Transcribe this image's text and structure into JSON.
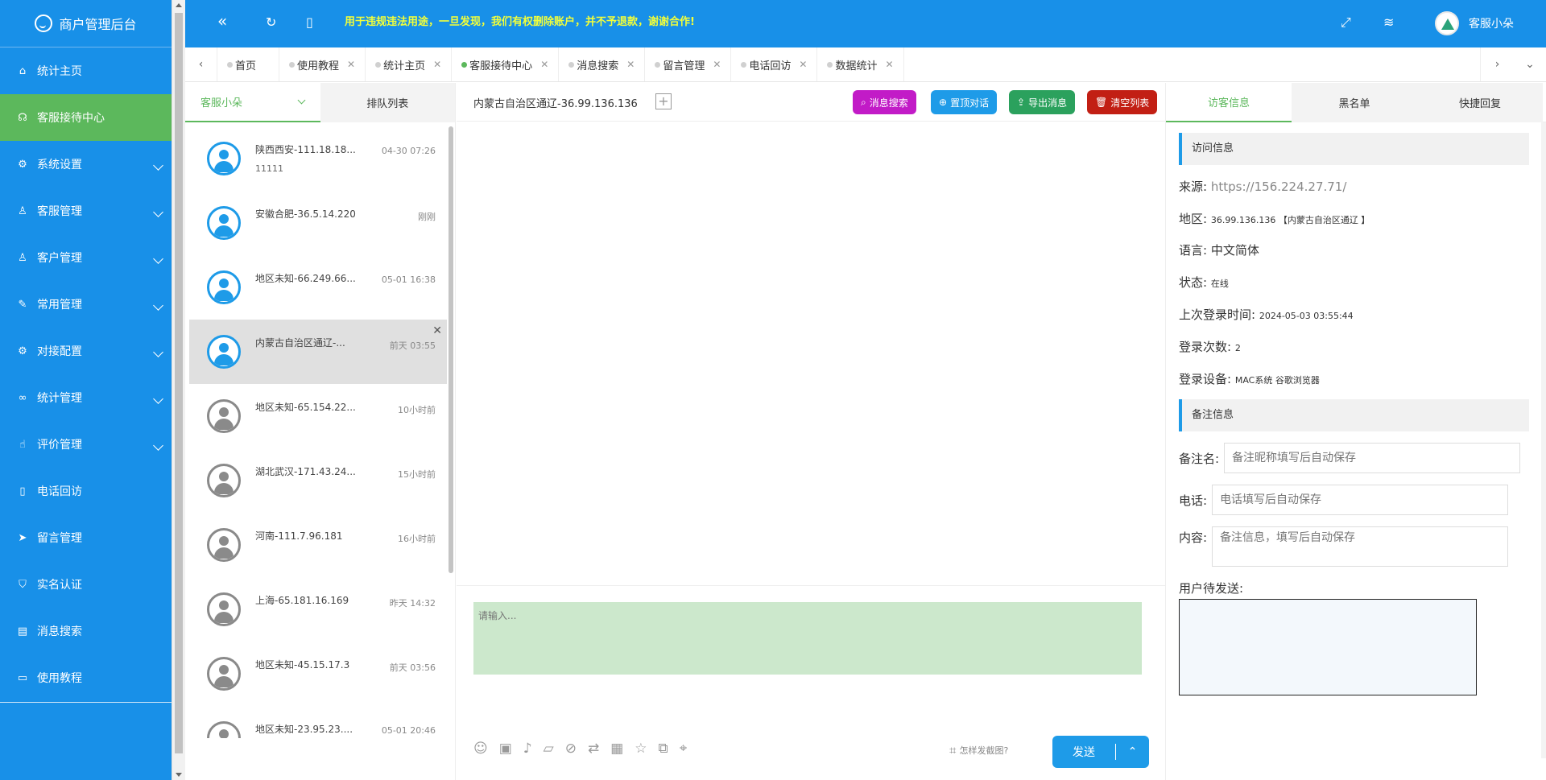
{
  "sidebar": {
    "brand": "商户管理后台",
    "items": [
      {
        "label": "统计主页",
        "icon": "home-icon",
        "glyph": "⌂",
        "has_children": false,
        "active": false
      },
      {
        "label": "客服接待中心",
        "icon": "headset-icon",
        "glyph": "☊",
        "has_children": false,
        "active": true
      },
      {
        "label": "系统设置",
        "icon": "gear-icon",
        "glyph": "⚙",
        "has_children": true,
        "active": false
      },
      {
        "label": "客服管理",
        "icon": "user-icon",
        "glyph": "♙",
        "has_children": true,
        "active": false
      },
      {
        "label": "客户管理",
        "icon": "users-icon",
        "glyph": "♙",
        "has_children": true,
        "active": false
      },
      {
        "label": "常用管理",
        "icon": "edit-icon",
        "glyph": "✎",
        "has_children": true,
        "active": false
      },
      {
        "label": "对接配置",
        "icon": "settings-icon",
        "glyph": "⚙",
        "has_children": true,
        "active": false
      },
      {
        "label": "统计管理",
        "icon": "link-icon",
        "glyph": "∞",
        "has_children": true,
        "active": false
      },
      {
        "label": "评价管理",
        "icon": "thumb-up-icon",
        "glyph": "☝",
        "has_children": true,
        "active": false
      },
      {
        "label": "电话回访",
        "icon": "phone-icon",
        "glyph": "▯",
        "has_children": false,
        "active": false
      },
      {
        "label": "留言管理",
        "icon": "send-icon",
        "glyph": "➤",
        "has_children": false,
        "active": false
      },
      {
        "label": "实名认证",
        "icon": "shield-check-icon",
        "glyph": "⛉",
        "has_children": false,
        "active": false
      },
      {
        "label": "消息搜索",
        "icon": "clipboard-icon",
        "glyph": "▤",
        "has_children": false,
        "active": false
      },
      {
        "label": "使用教程",
        "icon": "book-icon",
        "glyph": "▭",
        "has_children": false,
        "active": false
      }
    ]
  },
  "topbar": {
    "notice": "用于违规违法用途，一旦发现，我们有权删除账户，并不予退款，谢谢合作!",
    "username": "客服小朵",
    "notice_color": "#f2ff3a"
  },
  "tabs": [
    {
      "label": "首页",
      "closable": false,
      "active": false
    },
    {
      "label": "使用教程",
      "closable": true,
      "active": false
    },
    {
      "label": "统计主页",
      "closable": true,
      "active": false
    },
    {
      "label": "客服接待中心",
      "closable": true,
      "active": true
    },
    {
      "label": "消息搜索",
      "closable": true,
      "active": false
    },
    {
      "label": "留言管理",
      "closable": true,
      "active": false
    },
    {
      "label": "电话回访",
      "closable": true,
      "active": false
    },
    {
      "label": "数据统计",
      "closable": true,
      "active": false
    }
  ],
  "conversations": {
    "tab_agent": "客服小朵",
    "tab_queue": "排队列表",
    "items": [
      {
        "name": "陕西西安-111.18.18...",
        "sub": "11111",
        "time": "04-30 07:26",
        "online": true,
        "selected": false
      },
      {
        "name": "安徽合肥-36.5.14.220",
        "sub": "",
        "time": "刚刚",
        "online": true,
        "selected": false
      },
      {
        "name": "地区未知-66.249.66...",
        "sub": "",
        "time": "05-01 16:38",
        "online": true,
        "selected": false
      },
      {
        "name": "内蒙古自治区通辽-...",
        "sub": "",
        "time": "前天 03:55",
        "online": true,
        "selected": true
      },
      {
        "name": "地区未知-65.154.22...",
        "sub": "",
        "time": "10小时前",
        "online": false,
        "selected": false
      },
      {
        "name": "湖北武汉-171.43.24...",
        "sub": "",
        "time": "15小时前",
        "online": false,
        "selected": false
      },
      {
        "name": "河南-111.7.96.181",
        "sub": "",
        "time": "16小时前",
        "online": false,
        "selected": false
      },
      {
        "name": "上海-65.181.16.169",
        "sub": "",
        "time": "昨天 14:32",
        "online": false,
        "selected": false
      },
      {
        "name": "地区未知-45.15.17.3",
        "sub": "",
        "time": "前天 03:56",
        "online": false,
        "selected": false
      },
      {
        "name": "地区未知-23.95.23....",
        "sub": "",
        "time": "05-01 20:46",
        "online": false,
        "selected": false
      }
    ]
  },
  "chat": {
    "title": "内蒙古自治区通辽-36.99.136.136",
    "buttons": {
      "search": "消息搜索",
      "top": "置顶对话",
      "export": "导出消息",
      "clear": "清空列表"
    },
    "input_placeholder": "请输入...",
    "screenshot_hint": "怎样发截图?",
    "send_label": "发送"
  },
  "right_panel": {
    "tabs": [
      "访客信息",
      "黑名单",
      "快捷回复"
    ],
    "visit_title": "访问信息",
    "source_label": "来源:",
    "source_value": "https://156.224.27.71/",
    "region_label": "地区:",
    "region_value": "36.99.136.136 【内蒙古自治区通辽 】",
    "language_label": "语言:",
    "language_value": "中文简体",
    "status_label": "状态:",
    "status_value": "在线",
    "last_login_label": "上次登录时间:",
    "last_login_value": "2024-05-03 03:55:44",
    "login_count_label": "登录次数:",
    "login_count_value": "2",
    "device_label": "登录设备:",
    "device_value": "MAC系统 谷歌浏览器",
    "remark_title": "备注信息",
    "remark_name_label": "备注名:",
    "remark_name_placeholder": "备注昵称填写后自动保存",
    "phone_label": "电话:",
    "phone_placeholder": "电话填写后自动保存",
    "content_label": "内容:",
    "content_placeholder": "备注信息，填写后自动保存",
    "pending_label": "用户待发送:"
  },
  "colors": {
    "primary": "#1890e8",
    "active_green": "#5cb85c",
    "input_bg": "#cce8cc"
  }
}
